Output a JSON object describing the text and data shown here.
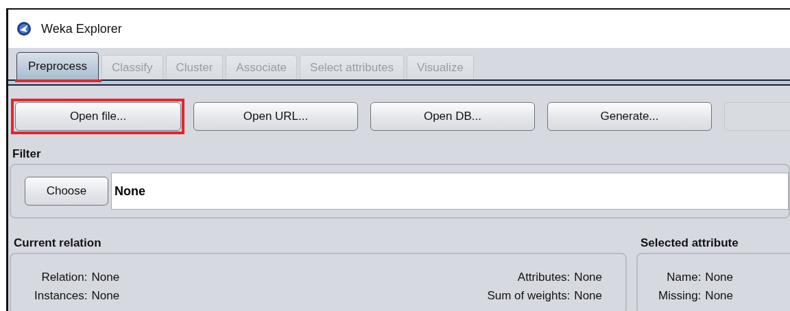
{
  "window": {
    "title": "Weka Explorer"
  },
  "tabs": [
    {
      "label": "Preprocess",
      "selected": true,
      "disabled": false,
      "highlighted": true
    },
    {
      "label": "Classify",
      "selected": false,
      "disabled": true,
      "highlighted": false
    },
    {
      "label": "Cluster",
      "selected": false,
      "disabled": true,
      "highlighted": false
    },
    {
      "label": "Associate",
      "selected": false,
      "disabled": true,
      "highlighted": false
    },
    {
      "label": "Select attributes",
      "selected": false,
      "disabled": true,
      "highlighted": false
    },
    {
      "label": "Visualize",
      "selected": false,
      "disabled": true,
      "highlighted": false
    }
  ],
  "buttons": [
    {
      "label": "Open file...",
      "disabled": false,
      "highlighted": true
    },
    {
      "label": "Open URL...",
      "disabled": false,
      "highlighted": false
    },
    {
      "label": "Open DB...",
      "disabled": false,
      "highlighted": false
    },
    {
      "label": "Generate...",
      "disabled": false,
      "highlighted": false
    },
    {
      "disabled": true,
      "highlighted": false
    }
  ],
  "filter": {
    "title": "Filter",
    "button": "Choose",
    "value": "None"
  },
  "current_relation": {
    "title": "Current relation",
    "left": [
      {
        "label": "Relation:",
        "value": "None"
      },
      {
        "label": "Instances:",
        "value": "None"
      }
    ],
    "right": [
      {
        "label": "Attributes:",
        "value": "None"
      },
      {
        "label": "Sum of weights:",
        "value": "None"
      }
    ]
  },
  "selected_attribute": {
    "title": "Selected attribute",
    "fields": [
      {
        "label": "Name:",
        "value": "None"
      },
      {
        "label": "Missing:",
        "value": "None"
      }
    ]
  }
}
